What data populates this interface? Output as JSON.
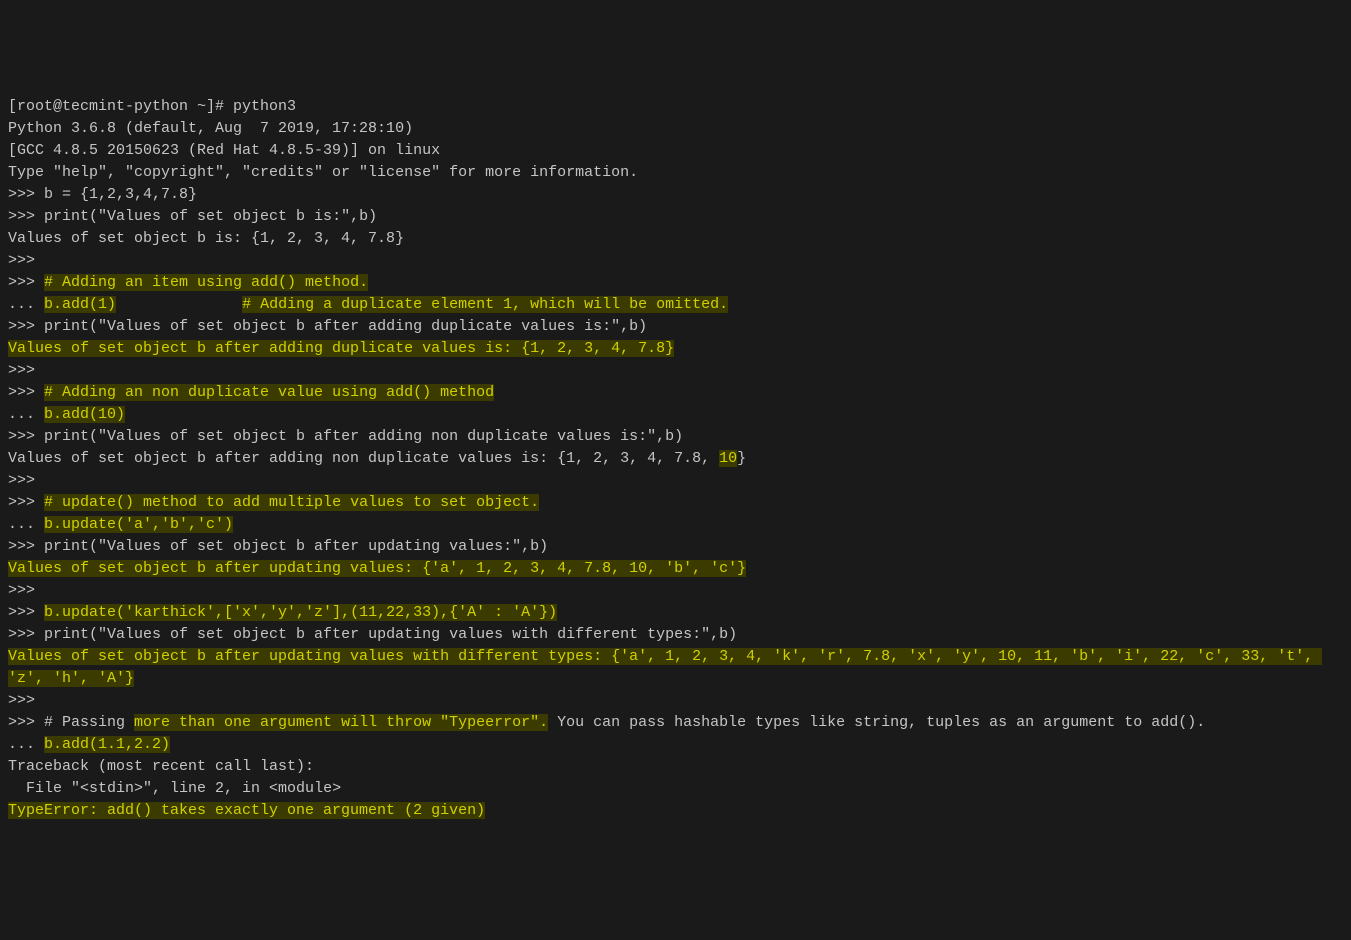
{
  "session": {
    "shell_prompt_user": "[root@tecmint-python ~]# ",
    "shell_cmd": "python3",
    "version_line": "Python 3.6.8 (default, Aug  7 2019, 17:28:10)",
    "gcc_line": "[GCC 4.8.5 20150623 (Red Hat 4.8.5-39)] on linux",
    "help_line": "Type \"help\", \"copyright\", \"credits\" or \"license\" for more information.",
    "ps1": ">>> ",
    "ps2": "... ",
    "lines": [
      "b = {1,2,3,4,7.8}",
      "print(\"Values of set object b is:\",b)"
    ],
    "out1": "Values of set object b is: {1, 2, 3, 4, 7.8}",
    "blank": "",
    "comment_add": "# Adding an item using add() method.",
    "add_dup_code": "b.add(1)",
    "add_dup_comment_pad": "              ",
    "add_dup_comment": "# Adding a duplicate element 1, which will be omitted.",
    "print_dup": "print(\"Values of set object b after adding duplicate values is:\",b)",
    "out_dup": "Values of set object b after adding duplicate values is: {1, 2, 3, 4, 7.8}",
    "comment_nondup": "# Adding an non duplicate value using add() method",
    "add_nondup_code": "b.add(10)",
    "print_nondup": "print(\"Values of set object b after adding non duplicate values is:\",b)",
    "out_nondup_prefix": "Values of set object b after adding non duplicate values is: {1, 2, 3, 4, 7.8, ",
    "out_nondup_new": "10",
    "out_nondup_suffix": "}",
    "comment_update": "# update() method to add multiple values to set object.",
    "update_code": "b.update('a','b','c')",
    "print_update": "print(\"Values of set object b after updating values:\",b)",
    "out_update": "Values of set object b after updating values: {'a', 1, 2, 3, 4, 7.8, 10, 'b', 'c'}",
    "update_mixed": "b.update('karthick',['x','y','z'],(11,22,33),{'A' : 'A'})",
    "print_update_mixed": "print(\"Values of set object b after updating values with different types:\",b)",
    "out_update_mixed": "Values of set object b after updating values with different types: {'a', 1, 2, 3, 4, 'k', 'r', 7.8, 'x', 'y', 10, 11, 'b', 'i', 22, 'c', 33, 't', 'z', 'h', 'A'}",
    "pass_comment_1": "# Passing ",
    "pass_comment_hl": "more than one argument will throw \"Typeerror\".",
    "pass_comment_2": " You can pass hashable types like string, tuples as an argument to add().",
    "bad_add": "b.add(1.1,2.2)",
    "traceback1": "Traceback (most recent call last):",
    "traceback2": "  File \"<stdin>\", line 2, in <module>",
    "typeerror": "TypeError: add() takes exactly one argument (2 given)"
  }
}
